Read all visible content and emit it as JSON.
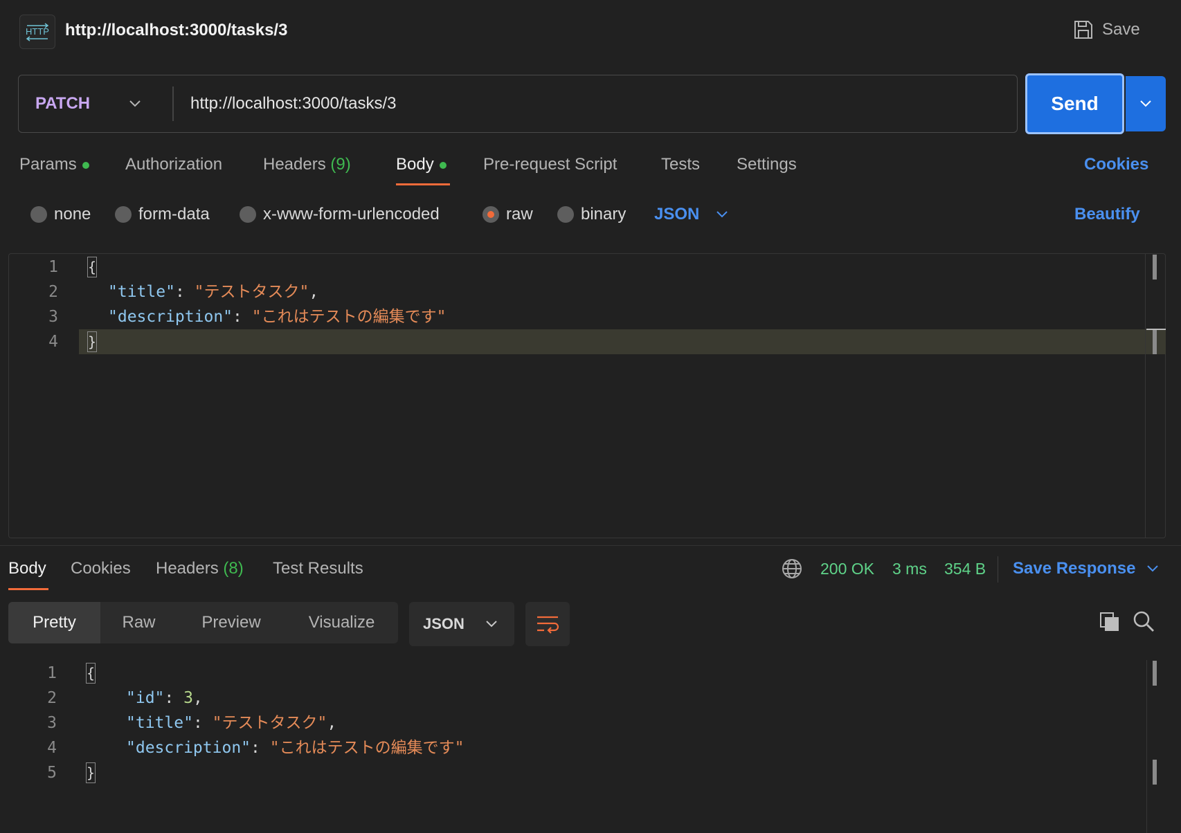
{
  "header": {
    "badge_text": "HTTP",
    "title": "http://localhost:3000/tasks/3",
    "save_label": "Save"
  },
  "request": {
    "method": "PATCH",
    "url": "http://localhost:3000/tasks/3",
    "send_label": "Send",
    "tabs": {
      "params": "Params",
      "authorization": "Authorization",
      "headers": "Headers",
      "headers_count": "(9)",
      "body": "Body",
      "pre_request": "Pre-request Script",
      "tests": "Tests",
      "settings": "Settings"
    },
    "cookies_link": "Cookies",
    "body_types": {
      "none": "none",
      "form_data": "form-data",
      "urlencoded": "x-www-form-urlencoded",
      "raw": "raw",
      "binary": "binary",
      "format": "JSON"
    },
    "beautify": "Beautify",
    "code": {
      "line_numbers": [
        "1",
        "2",
        "3",
        "4"
      ],
      "open": "{",
      "close": "}",
      "title_key": "\"title\"",
      "title_value": "\"テストタスク\"",
      "description_key": "\"description\"",
      "description_value": "\"これはテストの編集です\""
    }
  },
  "response": {
    "tabs": {
      "body": "Body",
      "cookies": "Cookies",
      "headers": "Headers",
      "headers_count": "(8)",
      "test_results": "Test Results"
    },
    "status": "200 OK",
    "time": "3 ms",
    "size": "354 B",
    "save_response": "Save Response",
    "views": {
      "pretty": "Pretty",
      "raw": "Raw",
      "preview": "Preview",
      "visualize": "Visualize"
    },
    "format": "JSON",
    "code": {
      "line_numbers": [
        "1",
        "2",
        "3",
        "4",
        "5"
      ],
      "open": "{",
      "close": "}",
      "id_key": "\"id\"",
      "id_value": "3",
      "title_key": "\"title\"",
      "title_value": "\"テストタスク\"",
      "description_key": "\"description\"",
      "description_value": "\"これはテストの編集です\""
    }
  },
  "colors": {
    "accent_orange": "#f26b3a",
    "send_blue": "#1e6fe0",
    "status_green": "#5fd389",
    "link_blue": "#4a90f0",
    "method_purple": "#c8a7f0"
  }
}
